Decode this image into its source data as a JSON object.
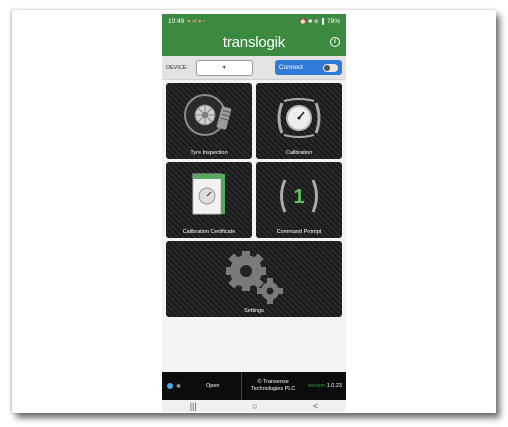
{
  "status_bar": {
    "time": "10:49",
    "left_icons": "♥ ✉ ♥ •",
    "right_icons": "⏰ ✱ ⊚ ▐",
    "battery": "78%"
  },
  "app": {
    "title": "translogik",
    "info_icon": "i"
  },
  "device_bar": {
    "label": "DEVICE:",
    "select_value": "",
    "connect_label": "Connect",
    "connected": false
  },
  "tiles": [
    {
      "label": "Tyre Inspection",
      "icon": "tyre-icon"
    },
    {
      "label": "Calibration",
      "icon": "gauge-icon"
    },
    {
      "label": "Calibration Certificate",
      "icon": "certificate-icon"
    },
    {
      "label": "Command Prompt",
      "icon": "command-prompt-icon"
    },
    {
      "label": "Settings",
      "icon": "gears-icon"
    }
  ],
  "bottom_bar": {
    "status": "Open",
    "copyright_line1": "© Transense",
    "copyright_line2": "Technologies PLC",
    "version_label": "version",
    "version_number": "1.0.23"
  },
  "nav": {
    "recent": "|||",
    "home": "○",
    "back": "<"
  },
  "colors": {
    "brand_green": "#3c8a3f",
    "connect_blue": "#2f7bd6",
    "bluetooth_blue": "#4aa8e8"
  }
}
